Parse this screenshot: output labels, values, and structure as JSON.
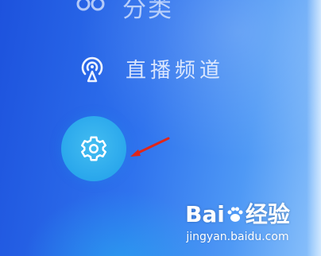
{
  "menu": {
    "items": [
      {
        "label": "分类",
        "icon": "category-icon"
      },
      {
        "label": "直播频道",
        "icon": "live-channel-icon"
      }
    ]
  },
  "settings_button": {
    "icon": "gear-icon"
  },
  "annotation": {
    "color": "#e0261a"
  },
  "watermark": {
    "logo_prefix": "Bai",
    "logo_suffix": "经验",
    "url": "jingyan.baidu.com"
  }
}
